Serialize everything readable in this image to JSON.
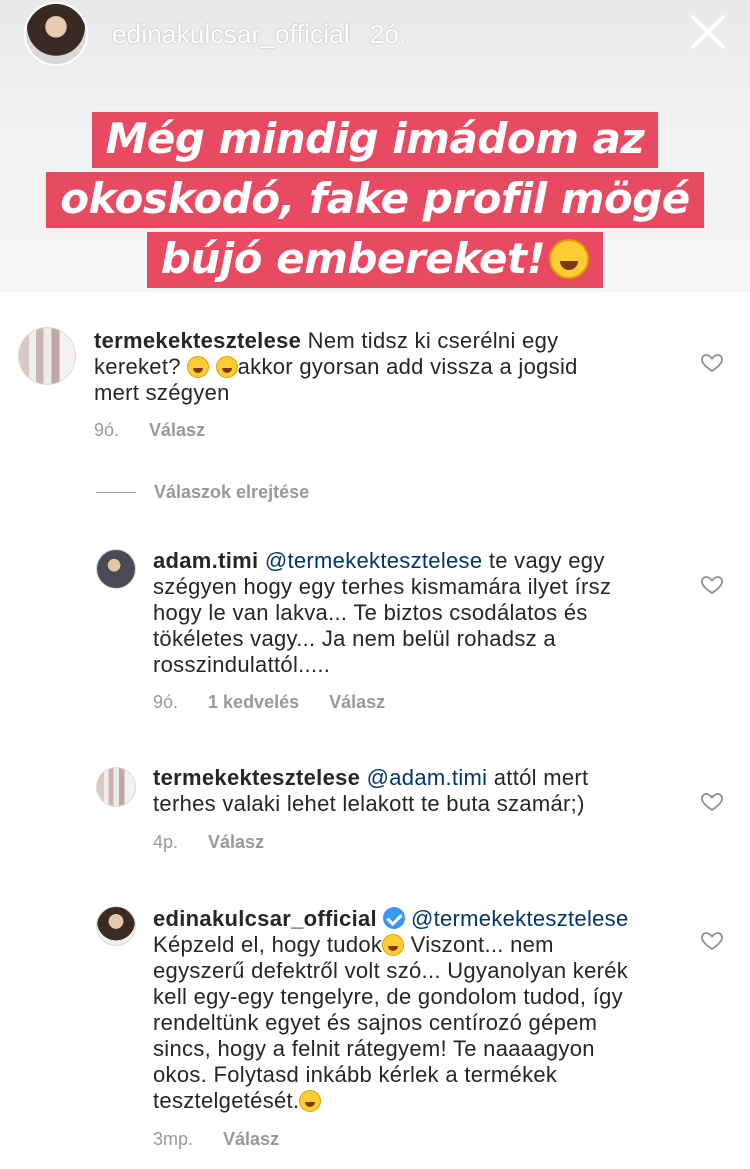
{
  "story": {
    "username": "edinakulcsar_official",
    "time": "2ó.",
    "overlay_lines": [
      "Még mindig imádom az",
      "okoskodó, fake profil mögé",
      "bújó embereket!"
    ],
    "overlay_emoji": "tears-of-joy-emoji"
  },
  "comments": [
    {
      "username": "termekektesztelese",
      "text_lines": [
        "Nem tidsz ki cserélni egy",
        "kereket? ",
        "akkor gyorsan add vissza a jogsid",
        "mert szégyen"
      ],
      "time": "9ó.",
      "reply": "Válasz"
    },
    {
      "username": "adam.timi",
      "mention": "@termekektesztelese",
      "text_lines": [
        "te vagy egy",
        "szégyen hogy egy terhes kismamára ilyet írsz",
        "hogy le van lakva... Te biztos csodálatos és",
        "tökéletes vagy... Ja nem belül rohadsz a",
        "rosszindulattól....."
      ],
      "time": "9ó.",
      "likes": "1 kedvelés",
      "reply": "Válasz"
    },
    {
      "username": "termekektesztelese",
      "mention": "@adam.timi",
      "text_lines": [
        "attól mert",
        "terhes valaki lehet lelakott te buta szamár;)"
      ],
      "time": "4p.",
      "reply": "Válasz"
    },
    {
      "username": "edinakulcsar_official",
      "mention": "@termekektesztelese",
      "text_lines": [
        "Képzeld el, hogy tudok",
        " Viszont... nem",
        "egyszerű defektről volt szó... Ugyanolyan kerék",
        "kell egy-egy tengelyre, de gondolom tudod, így",
        "rendeltünk egyet és sajnos centírozó gépem",
        "sincs, hogy a felnit rátegyem! Te naaaagyon",
        "okos. Folytasd inkább kérlek a termékek",
        "tesztelgetését."
      ],
      "time": "3mp.",
      "reply": "Válasz"
    }
  ],
  "hide_replies": "Válaszok elrejtése"
}
